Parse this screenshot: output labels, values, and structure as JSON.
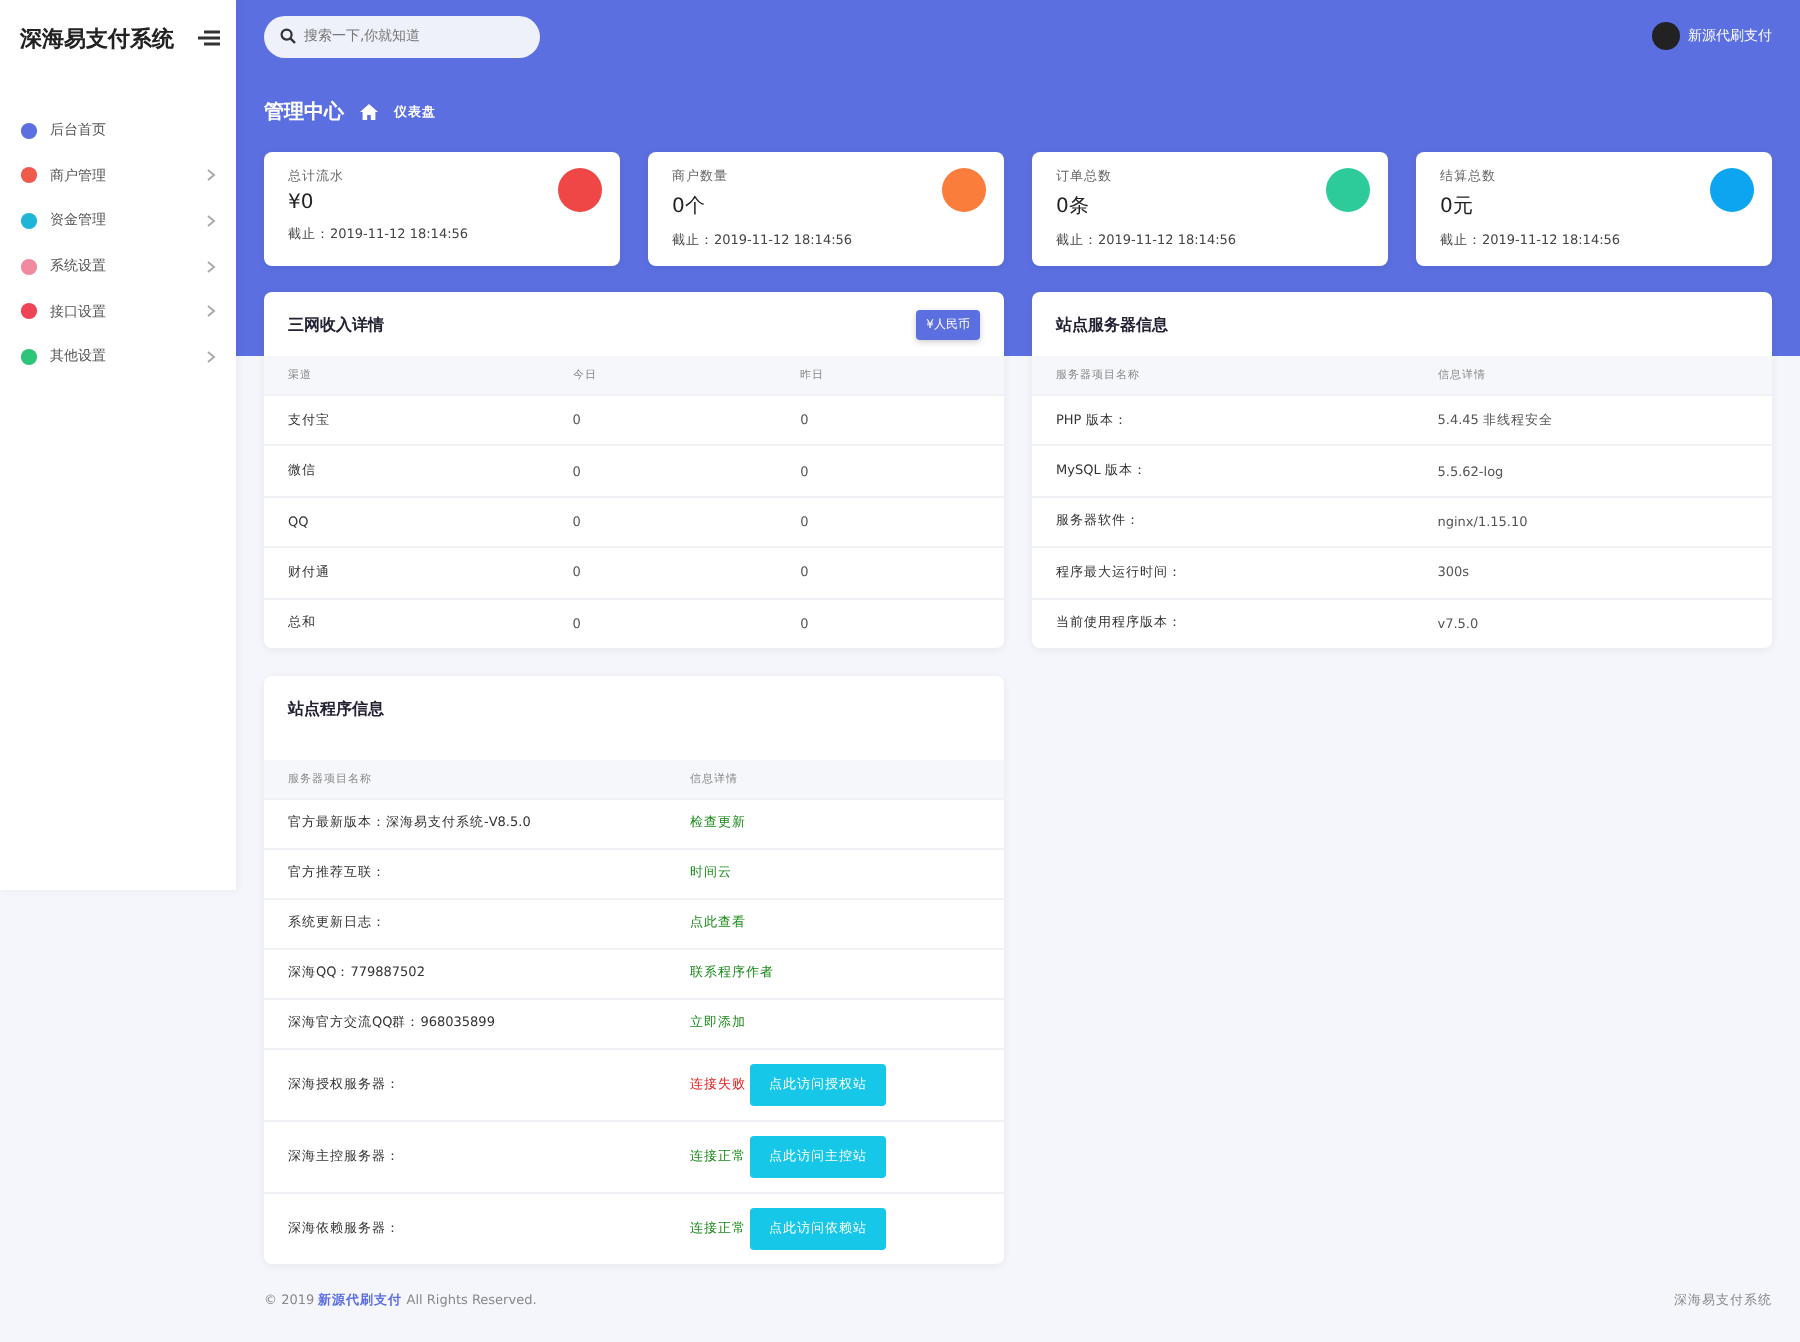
{
  "brand": "深海易支付系统",
  "sidebar": {
    "items": [
      {
        "label": "后台首页",
        "has_arrow": false
      },
      {
        "label": "商户管理",
        "has_arrow": true
      },
      {
        "label": "资金管理",
        "has_arrow": true
      },
      {
        "label": "系统设置",
        "has_arrow": true
      },
      {
        "label": "接口设置",
        "has_arrow": true
      },
      {
        "label": "其他设置",
        "has_arrow": true
      }
    ]
  },
  "search": {
    "placeholder": "搜索一下,你就知道"
  },
  "user": {
    "name": "新源代刷支付"
  },
  "page_title": "管理中心",
  "breadcrumb": "仪表盘",
  "stats": [
    {
      "label": "总计流水",
      "value": "¥0",
      "time": "截止：2019-11-12 18:14:56",
      "color": "#ef4646"
    },
    {
      "label": "商户数量",
      "value": "0个",
      "time": "截止：2019-11-12 18:14:56",
      "color": "#fb7d3c"
    },
    {
      "label": "订单总数",
      "value": "0条",
      "time": "截止：2019-11-12 18:14:56",
      "color": "#2ecb9a"
    },
    {
      "label": "结算总数",
      "value": "0元",
      "time": "截止：2019-11-12 18:14:56",
      "color": "#0ea5f0"
    }
  ],
  "income": {
    "title": "三网收入详情",
    "button": "¥人民币",
    "columns": [
      "渠道",
      "今日",
      "昨日"
    ],
    "rows": [
      [
        "支付宝",
        "0",
        "0"
      ],
      [
        "微信",
        "0",
        "0"
      ],
      [
        "QQ",
        "0",
        "0"
      ],
      [
        "财付通",
        "0",
        "0"
      ],
      [
        "总和",
        "0",
        "0"
      ]
    ]
  },
  "server": {
    "title": "站点服务器信息",
    "columns": [
      "服务器项目名称",
      "信息详情"
    ],
    "rows": [
      [
        "PHP 版本：",
        "5.4.45 非线程安全"
      ],
      [
        "MySQL 版本：",
        "5.5.62-log"
      ],
      [
        "服务器软件：",
        "nginx/1.15.10"
      ],
      [
        "程序最大运行时间：",
        "300s"
      ],
      [
        "当前使用程序版本：",
        "v7.5.0"
      ]
    ]
  },
  "program": {
    "title": "站点程序信息",
    "columns": [
      "服务器项目名称",
      "信息详情"
    ],
    "rows": [
      {
        "name": "官方最新版本：深海易支付系统-V8.5.0",
        "status": "检查更新",
        "ok": true
      },
      {
        "name": "官方推荐互联：",
        "status": "时间云",
        "ok": true
      },
      {
        "name": "系统更新日志：",
        "status": "点此查看",
        "ok": true
      },
      {
        "name": "深海QQ：779887502",
        "status": "联系程序作者",
        "ok": true
      },
      {
        "name": "深海官方交流QQ群：968035899",
        "status": "立即添加",
        "ok": true
      },
      {
        "name": "深海授权服务器：",
        "status": "连接失败",
        "ok": false,
        "button": "点此访问授权站"
      },
      {
        "name": "深海主控服务器：",
        "status": "连接正常",
        "ok": true,
        "button": "点此访问主控站"
      },
      {
        "name": "深海依赖服务器：",
        "status": "连接正常",
        "ok": true,
        "button": "点此访问依赖站"
      }
    ]
  },
  "footer": {
    "prefix": "© 2019",
    "link": "新源代刷支付",
    "suffix": "All Rights Reserved.",
    "right": "深海易支付系统"
  }
}
